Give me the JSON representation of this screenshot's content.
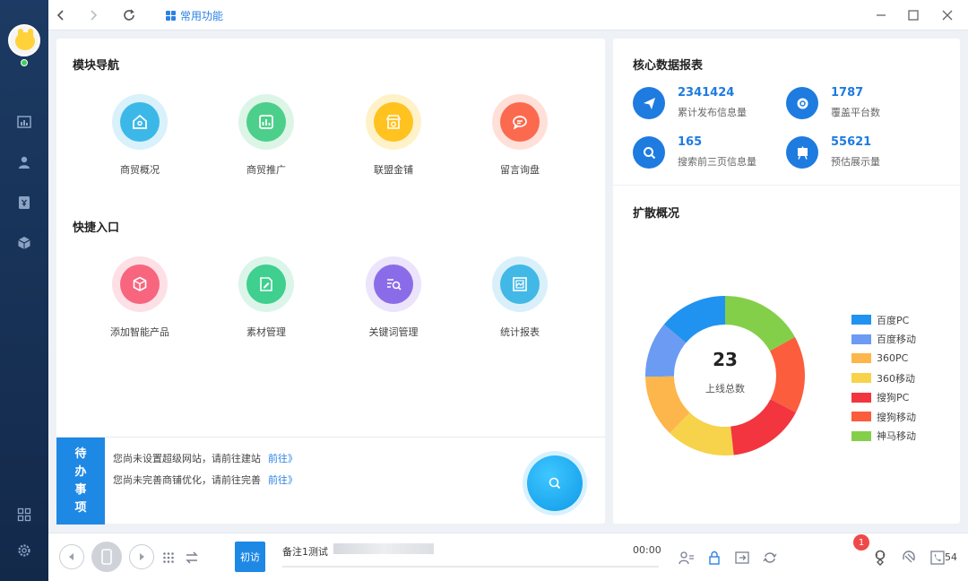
{
  "titlebar": {
    "tab_label": "常用功能",
    "back_icon": "chevron-left-icon",
    "forward_icon": "chevron-right-icon",
    "refresh_icon": "refresh-icon"
  },
  "modules": {
    "title": "模块导航",
    "items": [
      {
        "label": "商贸概况",
        "icon": "home-icon",
        "color": "#3cb8e8",
        "halo": "#d8f1fb"
      },
      {
        "label": "商贸推广",
        "icon": "chart-icon",
        "color": "#4ccf8a",
        "halo": "#dcf5e7"
      },
      {
        "label": "联盟金铺",
        "icon": "shop-icon",
        "color": "#ffc21f",
        "halo": "#fff2c9"
      },
      {
        "label": "留言询盘",
        "icon": "message-icon",
        "color": "#fb6a4e",
        "halo": "#ffe0d9"
      }
    ]
  },
  "shortcuts": {
    "title": "快捷入口",
    "items": [
      {
        "label": "添加智能产品",
        "icon": "box-icon",
        "color": "#f7667e",
        "halo": "#fde0e6"
      },
      {
        "label": "素材管理",
        "icon": "edit-doc-icon",
        "color": "#3fcf8e",
        "halo": "#dcf5ea"
      },
      {
        "label": "关键词管理",
        "icon": "search-list-icon",
        "color": "#8b6ce8",
        "halo": "#ebe4fb"
      },
      {
        "label": "统计报表",
        "icon": "report-icon",
        "color": "#42b8e6",
        "halo": "#d9f0fa"
      }
    ]
  },
  "todo": {
    "tag": [
      "待",
      "办",
      "事",
      "项"
    ],
    "items": [
      {
        "text": "您尚未设置超级网站，请前往建站",
        "link": "前往》"
      },
      {
        "text": "您尚未完善商铺优化，请前往完善",
        "link": "前往》"
      }
    ]
  },
  "core_stats": {
    "title": "核心数据报表",
    "items": [
      {
        "value": "2341424",
        "caption": "累计发布信息量",
        "icon": "send-icon"
      },
      {
        "value": "1787",
        "caption": "覆盖平台数",
        "icon": "disc-icon"
      },
      {
        "value": "165",
        "caption": "搜索前三页信息量",
        "icon": "search-icon"
      },
      {
        "value": "55621",
        "caption": "预估展示量",
        "icon": "display-icon"
      }
    ]
  },
  "spread": {
    "title": "扩散概况",
    "center_value": "23",
    "center_label": "上线总数"
  },
  "chart_data": {
    "type": "pie",
    "title": "扩散概况",
    "total": 23,
    "legend_position": "right",
    "series": [
      {
        "name": "百度PC",
        "value": 3.2,
        "color": "#1f93ef"
      },
      {
        "name": "百度移动",
        "value": 2.6,
        "color": "#6b9bf2"
      },
      {
        "name": "360PC",
        "value": 2.9,
        "color": "#fdb64b"
      },
      {
        "name": "360移动",
        "value": 3.2,
        "color": "#f7d24b"
      },
      {
        "name": "搜狗PC",
        "value": 3.6,
        "color": "#f2353f"
      },
      {
        "name": "搜狗移动",
        "value": 3.6,
        "color": "#fb5d3d"
      },
      {
        "name": "神马移动",
        "value": 3.9,
        "color": "#84cf4a"
      }
    ]
  },
  "bottombar": {
    "first_visit": "初访",
    "note": "备注1测试",
    "time": "00:00",
    "badge": "1",
    "count": "54"
  }
}
